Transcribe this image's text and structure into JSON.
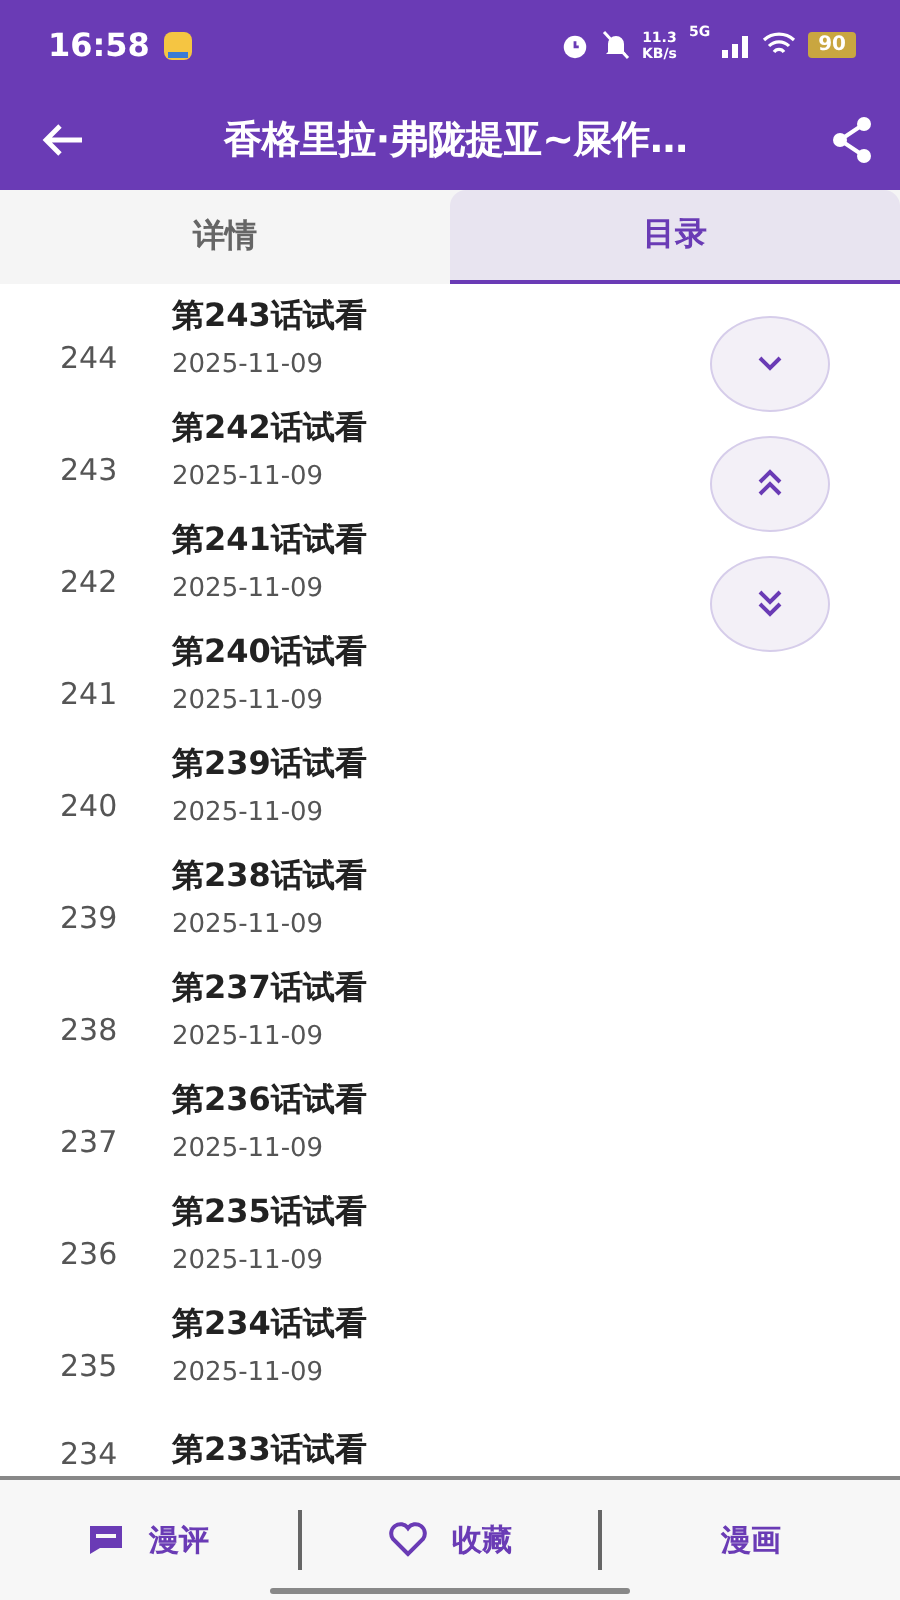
{
  "status_bar": {
    "time": "16:58",
    "network_speed": "11.3",
    "speed_unit": "KB/s",
    "network_type": "5G",
    "battery": "90"
  },
  "app_bar": {
    "title": "香格里拉·弗陇提亚~屎作…"
  },
  "tabs": [
    {
      "label": "详情",
      "selected": false
    },
    {
      "label": "目录",
      "selected": true
    }
  ],
  "chapters": [
    {
      "number": "244",
      "title": "第243话试看",
      "date": "2025-11-09"
    },
    {
      "number": "243",
      "title": "第242话试看",
      "date": "2025-11-09"
    },
    {
      "number": "242",
      "title": "第241话试看",
      "date": "2025-11-09"
    },
    {
      "number": "241",
      "title": "第240话试看",
      "date": "2025-11-09"
    },
    {
      "number": "240",
      "title": "第239话试看",
      "date": "2025-11-09"
    },
    {
      "number": "239",
      "title": "第238话试看",
      "date": "2025-11-09"
    },
    {
      "number": "238",
      "title": "第237话试看",
      "date": "2025-11-09"
    },
    {
      "number": "237",
      "title": "第236话试看",
      "date": "2025-11-09"
    },
    {
      "number": "236",
      "title": "第235话试看",
      "date": "2025-11-09"
    },
    {
      "number": "235",
      "title": "第234话试看",
      "date": "2025-11-09"
    },
    {
      "number": "234",
      "title": "第233话试看"
    }
  ],
  "scroll_buttons": [
    {
      "kind": "down"
    },
    {
      "kind": "top"
    },
    {
      "kind": "bottom"
    }
  ],
  "bottom_bar": [
    {
      "kind": "comment",
      "label": "漫评"
    },
    {
      "kind": "favorite",
      "label": "收藏"
    },
    {
      "kind": "read",
      "label": "漫画"
    }
  ]
}
